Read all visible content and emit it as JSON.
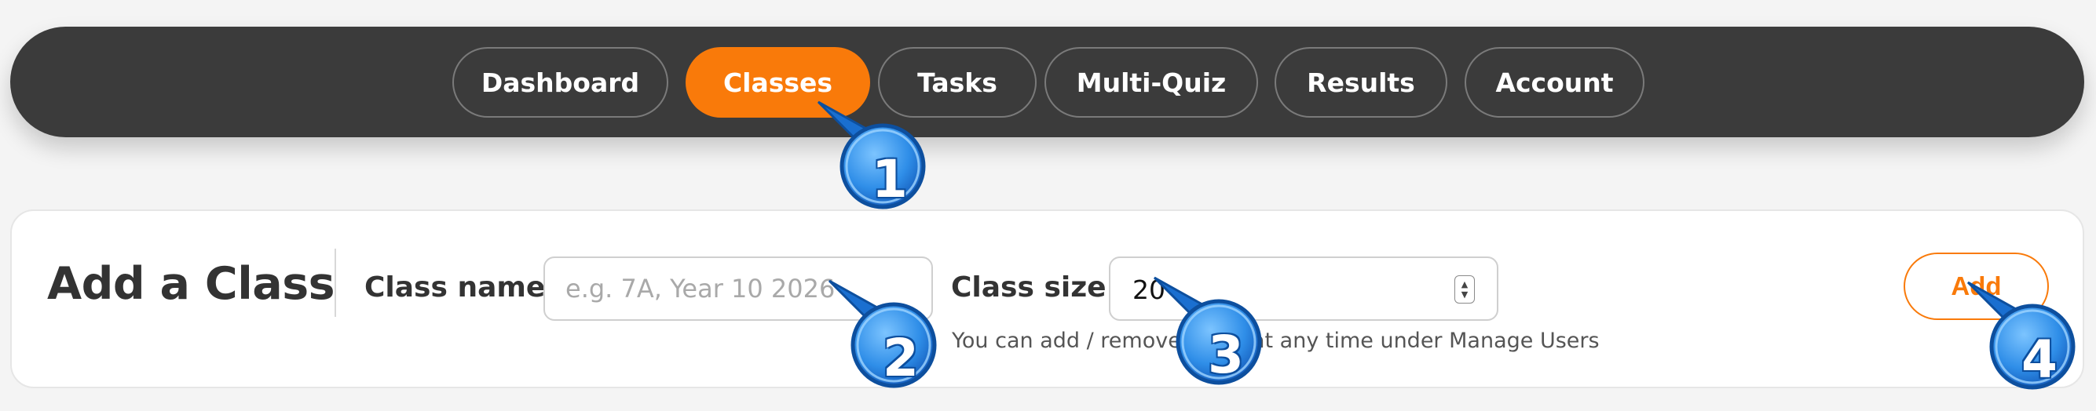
{
  "nav": {
    "items": [
      {
        "label": "Dashboard"
      },
      {
        "label": "Classes"
      },
      {
        "label": "Tasks"
      },
      {
        "label": "Multi-Quiz"
      },
      {
        "label": "Results"
      },
      {
        "label": "Account"
      }
    ],
    "active": "Classes"
  },
  "add_class": {
    "title": "Add a Class",
    "class_name_label": "Class name:",
    "class_name_placeholder": "e.g. 7A, Year 10 2026",
    "class_name_value": "",
    "class_size_label": "Class size:",
    "class_size_value": "20",
    "hint": "You can add / remove users at any time under Manage Users",
    "add_button": "Add"
  },
  "markers": [
    "1",
    "2",
    "3",
    "4"
  ],
  "colors": {
    "accent": "#f97a0a",
    "navbar_bg": "#3b3b3b",
    "marker_blue": "#2f8ee8"
  }
}
